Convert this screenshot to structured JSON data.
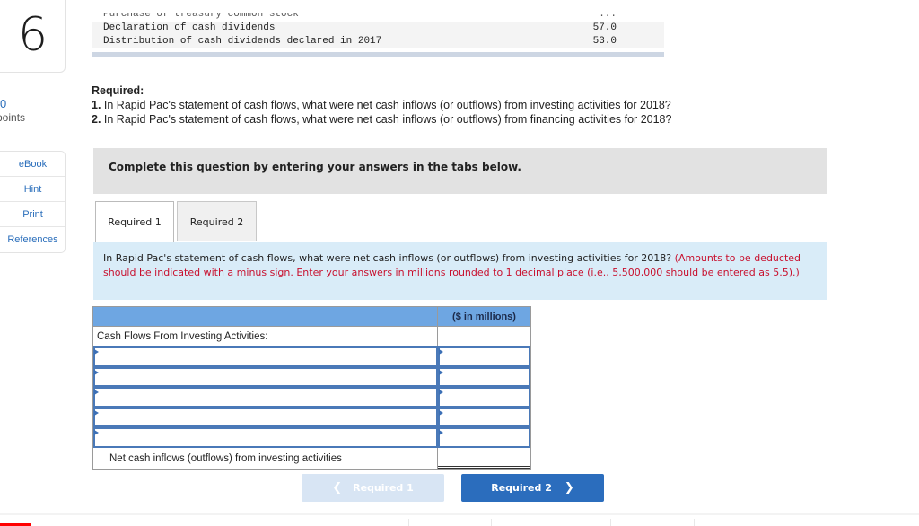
{
  "question": {
    "number": "6",
    "points_value": "0",
    "points_label": "points"
  },
  "side_links": [
    {
      "label": "eBook"
    },
    {
      "label": "Hint"
    },
    {
      "label": "Print"
    },
    {
      "label": "References"
    }
  ],
  "data_table": {
    "rows": [
      {
        "label": "Purchase of treasury common stock",
        "value": "...",
        "partial": true
      },
      {
        "label": "Declaration of cash dividends",
        "value": "57.0"
      },
      {
        "label": "Distribution of cash dividends declared in 2017",
        "value": "53.0"
      }
    ]
  },
  "required": {
    "heading": "Required:",
    "items": [
      {
        "num": "1.",
        "text": " In Rapid Pac's statement of cash flows, what were net cash inflows (or outflows) from investing activities for 2018?"
      },
      {
        "num": "2.",
        "text": " In Rapid Pac's statement of cash flows, what were net cash inflows (or outflows) from financing activities for 2018?"
      }
    ]
  },
  "instruction": "Complete this question by entering your answers in the tabs below.",
  "tabs": [
    {
      "label": "Required 1",
      "active": true
    },
    {
      "label": "Required 2",
      "active": false
    }
  ],
  "prompt": {
    "text": "In Rapid Pac's statement of cash flows, what were net cash inflows (or outflows) from investing activities for 2018? ",
    "note": "(Amounts to be deducted should be indicated with a minus sign. Enter your answers in millions rounded to 1 decimal place (i.e., 5,500,000 should be entered as 5.5).)"
  },
  "answer_table": {
    "column_header": "($ in millions)",
    "section_label": "Cash Flows From Investing Activities:",
    "input_rows": [
      {
        "label_value": "",
        "amount_value": ""
      },
      {
        "label_value": "",
        "amount_value": ""
      },
      {
        "label_value": "",
        "amount_value": ""
      },
      {
        "label_value": "",
        "amount_value": ""
      },
      {
        "label_value": "",
        "amount_value": ""
      }
    ],
    "total_label": "Net cash inflows (outflows) from investing activities",
    "total_value": ""
  },
  "nav": {
    "prev_label": "Required 1",
    "next_label": "Required 2",
    "prev_icon": "chevron-left-icon",
    "next_icon": "chevron-right-icon"
  },
  "colors": {
    "link": "#2a6ebb",
    "header_blue": "#6ea6e2",
    "panel_blue": "#d9ecf8",
    "note_red": "#c8102e",
    "primary_button": "#2b6dbd",
    "disabled_button": "#d8e5f4"
  }
}
